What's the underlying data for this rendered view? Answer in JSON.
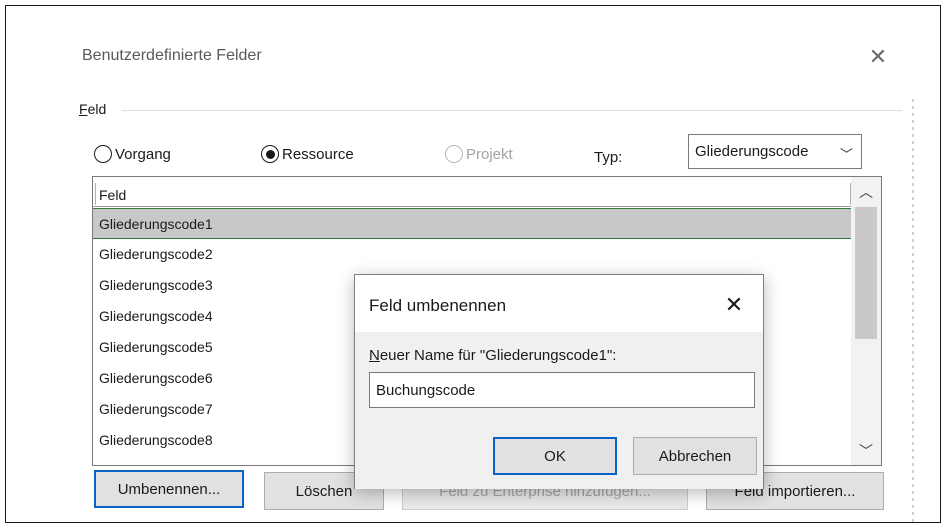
{
  "main_dialog": {
    "title": "Benutzerdefinierte Felder",
    "group_label_hotkey": "F",
    "group_label_rest": "eld",
    "radios": [
      {
        "label": "Vorgang",
        "checked": false,
        "enabled": true
      },
      {
        "label": "Ressource",
        "checked": true,
        "enabled": true
      },
      {
        "label": "Projekt",
        "checked": false,
        "enabled": false
      }
    ],
    "type_label": "Typ:",
    "type_value": "Gliederungscode",
    "list": {
      "header": "Feld",
      "rows": [
        "Gliederungscode1",
        "Gliederungscode2",
        "Gliederungscode3",
        "Gliederungscode4",
        "Gliederungscode5",
        "Gliederungscode6",
        "Gliederungscode7",
        "Gliederungscode8"
      ],
      "selected_index": 0
    },
    "buttons": {
      "rename": "Umbenennen...",
      "delete": "Löschen",
      "add_enterprise": "Feld zu Enterprise hinzufügen...",
      "import": "Feld importieren..."
    }
  },
  "rename_dialog": {
    "title": "Feld umbenennen",
    "label_hotkey": "N",
    "label_rest": "euer Name für \"Gliederungscode1\":",
    "input_value": "Buchungscode",
    "ok": "OK",
    "cancel": "Abbrechen"
  },
  "icons": {
    "close": "close-icon",
    "chevron_down": "chevron-down-icon",
    "scroll_up": "chevron-up-icon",
    "scroll_down": "chevron-down-icon"
  },
  "colors": {
    "selection_border": "#2e7d32",
    "focus_border": "#0a64c8",
    "selection_bg": "#c8c8c8"
  }
}
